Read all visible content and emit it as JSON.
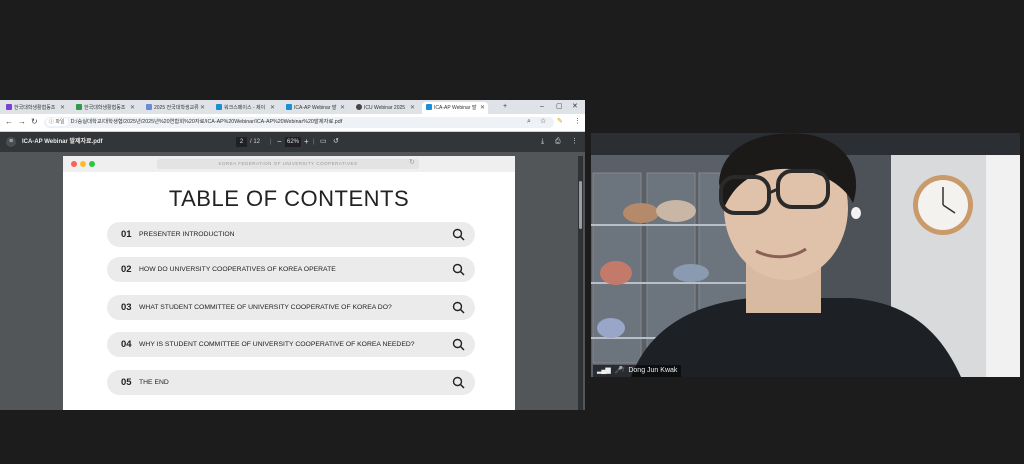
{
  "browser": {
    "tabs": [
      {
        "label": "한국대학생활협동조",
        "color": "#7b3fd1",
        "active": false
      },
      {
        "label": "한국대학생활협동조",
        "color": "#2e9a4b",
        "active": false
      },
      {
        "label": "2025 전국대학생교류",
        "color": "#6c8bd6",
        "active": false
      },
      {
        "label": "워크스페이스 - 제이",
        "color": "#1a8fd6",
        "active": false
      },
      {
        "label": "ICA-AP Webinar 발",
        "color": "#1a8fd6",
        "active": false
      },
      {
        "label": "ICU Webinar 2025",
        "color": "#444444",
        "active": false
      },
      {
        "label": "ICA-AP Webinar 발",
        "color": "#1a8fd6",
        "active": true
      }
    ],
    "new_tab_label": "+",
    "security_chip": "파일",
    "url": "D:/숭실대학교/대학생협/2025년/2025년%20연합회%20자료/ICA-AP%20Webinar/ICA-AP%20Webinar%20발제자료.pdf"
  },
  "pdf_viewer": {
    "file_name": "ICA-AP Webinar 발제자료.pdf",
    "current_page": "2",
    "total_pages": "/ 12",
    "zoom": "62%",
    "zoom_minus": "−",
    "zoom_plus": "+"
  },
  "slide": {
    "header_text": "KOREA FEDERATION OF UNIVERSITY COOPERATIVES",
    "title": "TABLE OF CONTENTS",
    "items": [
      {
        "num": "01",
        "text": "PRESENTER INTRODUCTION"
      },
      {
        "num": "02",
        "text": "HOW DO UNIVERSITY COOPERATIVES OF KOREA OPERATE"
      },
      {
        "num": "03",
        "text": "WHAT STUDENT COMMITTEE OF UNIVERSITY COOPERATIVE OF KOREA DO?"
      },
      {
        "num": "04",
        "text": "WHY IS STUDENT COMMITTEE OF UNIVERSITY COOPERATIVE OF KOREA NEEDED?"
      },
      {
        "num": "05",
        "text": "THE END"
      }
    ]
  },
  "participant": {
    "name": "Dong Jun Kwak"
  },
  "colors": {
    "background": "#1c1c1c",
    "pdf_toolbar": "#323639",
    "pdf_backdrop": "#525659",
    "toc_pill": "#ebebeb"
  }
}
